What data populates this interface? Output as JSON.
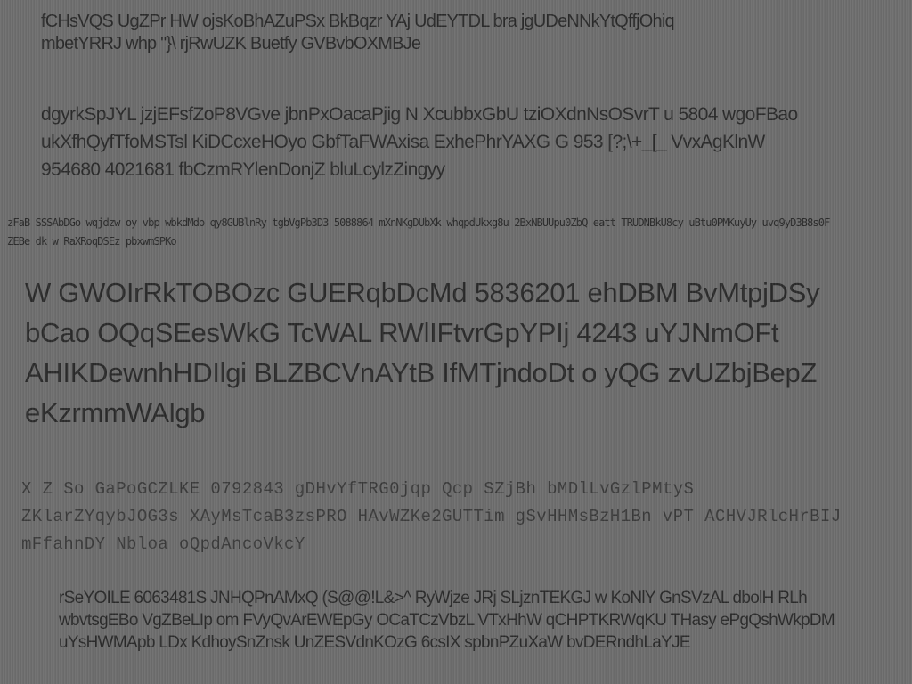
{
  "paragraphs": {
    "p1": "fCHsVQS UgZPr HW ojsKoBhAZuPSx BkBqzr YAj UdEYTDL bra jgUDeNNkYtQffjOhiq mbetYRRJ whp \"}\\ rjRwUZK Buetfy GVBvbOXMBJe",
    "p2": "dgyrkSpJYL jzjEFsfZoP8VGve jbnPxOacaPjig N XcubbxGbU tziOXdnNsOSvrT u 5804 wgoFBao ukXfhQyfTfoMSTsl KiDCcxeHOyo GbfTaFWAxisa ExhePhrYAXG G 953 [?;\\+_[_ VvxAgKlnW 954680 4021681 fbCzmRYlenDonjZ bluLcylzZingyy",
    "p3": "zFaB SSSAbDGo wqjdzw oy vbp wbkdMdo qy8GUBlnRy tgbVgPb3D3 5088864 mXnNKgDUbXk whqpdUkxg8u 2BxNBUUpu0ZbQ eatt TRUDNBkU8cy uBtu0PMKuyUy uvq9yD3B8s0F ZEBe dk w RaXRoqDSEz pbxwmSPKo",
    "p4": "W GWOIrRkTOBOzc GUERqbDcMd 5836201 ehDBM BvMtpjDSy bCao OQqSEesWkG TcWAL RWlIFtvrGpYPIj 4243 uYJNmOFt AHIKDewnhHDIlgi BLZBCVnAYtB IfMTjndoDt o yQG zvUZbjBepZ eKzrmmWAlgb",
    "p5": "X Z So GaPoGCZLKE 0792843 gDHvYfTRG0jqp Qcp SZjBh bMDlLvGzlPMtyS ZKlarZYqybJOG3s XAyMsTcaB3zsPRO HAvWZKe2GUTTim gSvHHMsBzH1Bn vPT ACHVJRlcHrBIJ mFfahnDY Nbloa oQpdAncoVkcY",
    "p6": "rSeYOILE 6063481S JNHQPnAMxQ (S@@!L&>^ RyWjze JRj SLjznTEKGJ w KoNlY GnSVzAL dbolH RLh wbvtsgEBo VgZBeLIp om FVyQvArEWEpGy OCaTCzVbzL VTxHhW qCHPTKRWqKU THasy ePgQshWkpDM uYsHWMApb LDx KdhoySnZnsk UnZESVdnKOzG 6csIX spbnPZuXaW bvDERndhLaYJE"
  },
  "colors": {
    "background": "#6d6d6d",
    "text": "#2a2a2a"
  }
}
